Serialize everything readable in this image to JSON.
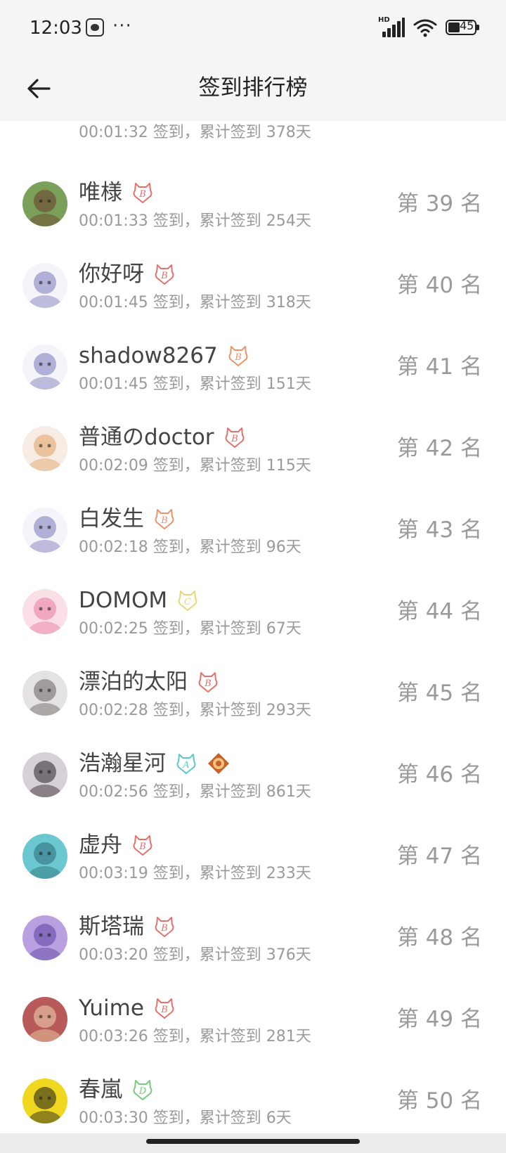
{
  "status_bar": {
    "time": "12:03",
    "more": "···",
    "signal_label": "HD",
    "battery": "45"
  },
  "header": {
    "title": "签到排行榜",
    "back_icon": "arrow-left-icon"
  },
  "partial_row": {
    "sub": "00:01:32 签到，累计签到 378天"
  },
  "rows": [
    {
      "name": "唯様",
      "sub": "00:01:33 签到，累计签到 254天",
      "rank": "第 39 名",
      "badges": [
        {
          "letter": "B",
          "color": "#e3726c"
        }
      ],
      "avatar_bg": "#7aa05a",
      "avatar_fg": "#6b3b2a"
    },
    {
      "name": "你好呀",
      "sub": "00:01:45 签到，累计签到 318天",
      "rank": "第 40 名",
      "badges": [
        {
          "letter": "B",
          "color": "#e3726c"
        }
      ],
      "avatar_bg": "#f4f4fa",
      "avatar_fg": "#7a78b8"
    },
    {
      "name": "shadow8267",
      "sub": "00:01:45 签到，累计签到 151天",
      "rank": "第 41 名",
      "badges": [
        {
          "letter": "B",
          "color": "#e8956a"
        }
      ],
      "avatar_bg": "#f4f4fa",
      "avatar_fg": "#7a78b8"
    },
    {
      "name": "普通のdoctor",
      "sub": "00:02:09 签到，累计签到 115天",
      "rank": "第 42 名",
      "badges": [
        {
          "letter": "B",
          "color": "#e3726c"
        }
      ],
      "avatar_bg": "#f6ece4",
      "avatar_fg": "#e0a060"
    },
    {
      "name": "白发生",
      "sub": "00:02:18 签到，累计签到 96天",
      "rank": "第 43 名",
      "badges": [
        {
          "letter": "B",
          "color": "#e8956a"
        }
      ],
      "avatar_bg": "#f4f4fa",
      "avatar_fg": "#7a78b8"
    },
    {
      "name": "DOMOM",
      "sub": "00:02:25 签到，累计签到 67天",
      "rank": "第 44 名",
      "badges": [
        {
          "letter": "C",
          "color": "#e8d77a"
        }
      ],
      "avatar_bg": "#fadfe6",
      "avatar_fg": "#e87a9a"
    },
    {
      "name": "漂泊的太阳",
      "sub": "00:02:28 签到，累计签到 293天",
      "rank": "第 45 名",
      "badges": [
        {
          "letter": "B",
          "color": "#e3726c"
        }
      ],
      "avatar_bg": "#e4e2e2",
      "avatar_fg": "#6a6062"
    },
    {
      "name": "浩瀚星河",
      "sub": "00:02:56 签到，累计签到 861天",
      "rank": "第 46 名",
      "badges": [
        {
          "letter": "A",
          "color": "#5cc8c8"
        },
        {
          "letter": "gem",
          "color": "#c8602a"
        }
      ],
      "avatar_bg": "#d8d0d8",
      "avatar_fg": "#2a2226"
    },
    {
      "name": "虚舟",
      "sub": "00:03:19 签到，累计签到 233天",
      "rank": "第 47 名",
      "badges": [
        {
          "letter": "B",
          "color": "#e3726c"
        }
      ],
      "avatar_bg": "#6cc8d0",
      "avatar_fg": "#2a6a78"
    },
    {
      "name": "斯塔瑞",
      "sub": "00:03:20 签到，累计签到 376天",
      "rank": "第 48 名",
      "badges": [
        {
          "letter": "B",
          "color": "#e3726c"
        }
      ],
      "avatar_bg": "#b8a0e0",
      "avatar_fg": "#5a40a0"
    },
    {
      "name": "Yuime",
      "sub": "00:03:26 签到，累计签到 281天",
      "rank": "第 49 名",
      "badges": [
        {
          "letter": "B",
          "color": "#e3726c"
        }
      ],
      "avatar_bg": "#b85a5a",
      "avatar_fg": "#f0d8b0"
    },
    {
      "name": "春嵐",
      "sub": "00:03:30 签到，累计签到 6天",
      "rank": "第 50 名",
      "badges": [
        {
          "letter": "D",
          "color": "#7ac87a"
        }
      ],
      "avatar_bg": "#f0d820",
      "avatar_fg": "#1a1a1a"
    }
  ]
}
